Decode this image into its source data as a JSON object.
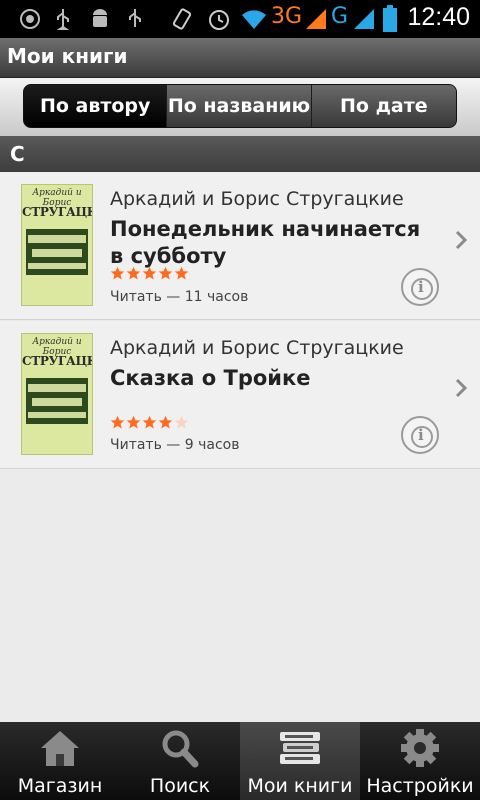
{
  "status_bar": {
    "time": "12:40",
    "network_3g": "3G",
    "network_g": "G"
  },
  "header": {
    "title": "Мои книги"
  },
  "sort_tabs": [
    {
      "label": "По автору",
      "active": true
    },
    {
      "label": "По названию",
      "active": false
    },
    {
      "label": "По дате",
      "active": false
    }
  ],
  "section": {
    "letter": "С"
  },
  "books": [
    {
      "author": "Аркадий и Борис Стругацкие",
      "title": "Понедельник начинается в субботу",
      "rating": 5,
      "read_time": "Читать — 11 часов",
      "cover_author": "Аркадий и Борис",
      "cover_title": "СТРУГАЦКИЕ"
    },
    {
      "author": "Аркадий и Борис Стругацкие",
      "title": "Сказка о Тройке",
      "rating": 4,
      "read_time": "Читать — 9 часов",
      "cover_author": "Аркадий и Борис",
      "cover_title": "СТРУГАЦКИЕ"
    }
  ],
  "bottom_tabs": [
    {
      "label": "Магазин",
      "icon": "home-icon",
      "active": false
    },
    {
      "label": "Поиск",
      "icon": "search-icon",
      "active": false
    },
    {
      "label": "Мои книги",
      "icon": "books-icon",
      "active": true
    },
    {
      "label": "Настройки",
      "icon": "gear-icon",
      "active": false
    }
  ],
  "colors": {
    "accent_orange": "#ff7a1a",
    "accent_blue": "#2aa7e6",
    "star": "#ff6a1f"
  }
}
